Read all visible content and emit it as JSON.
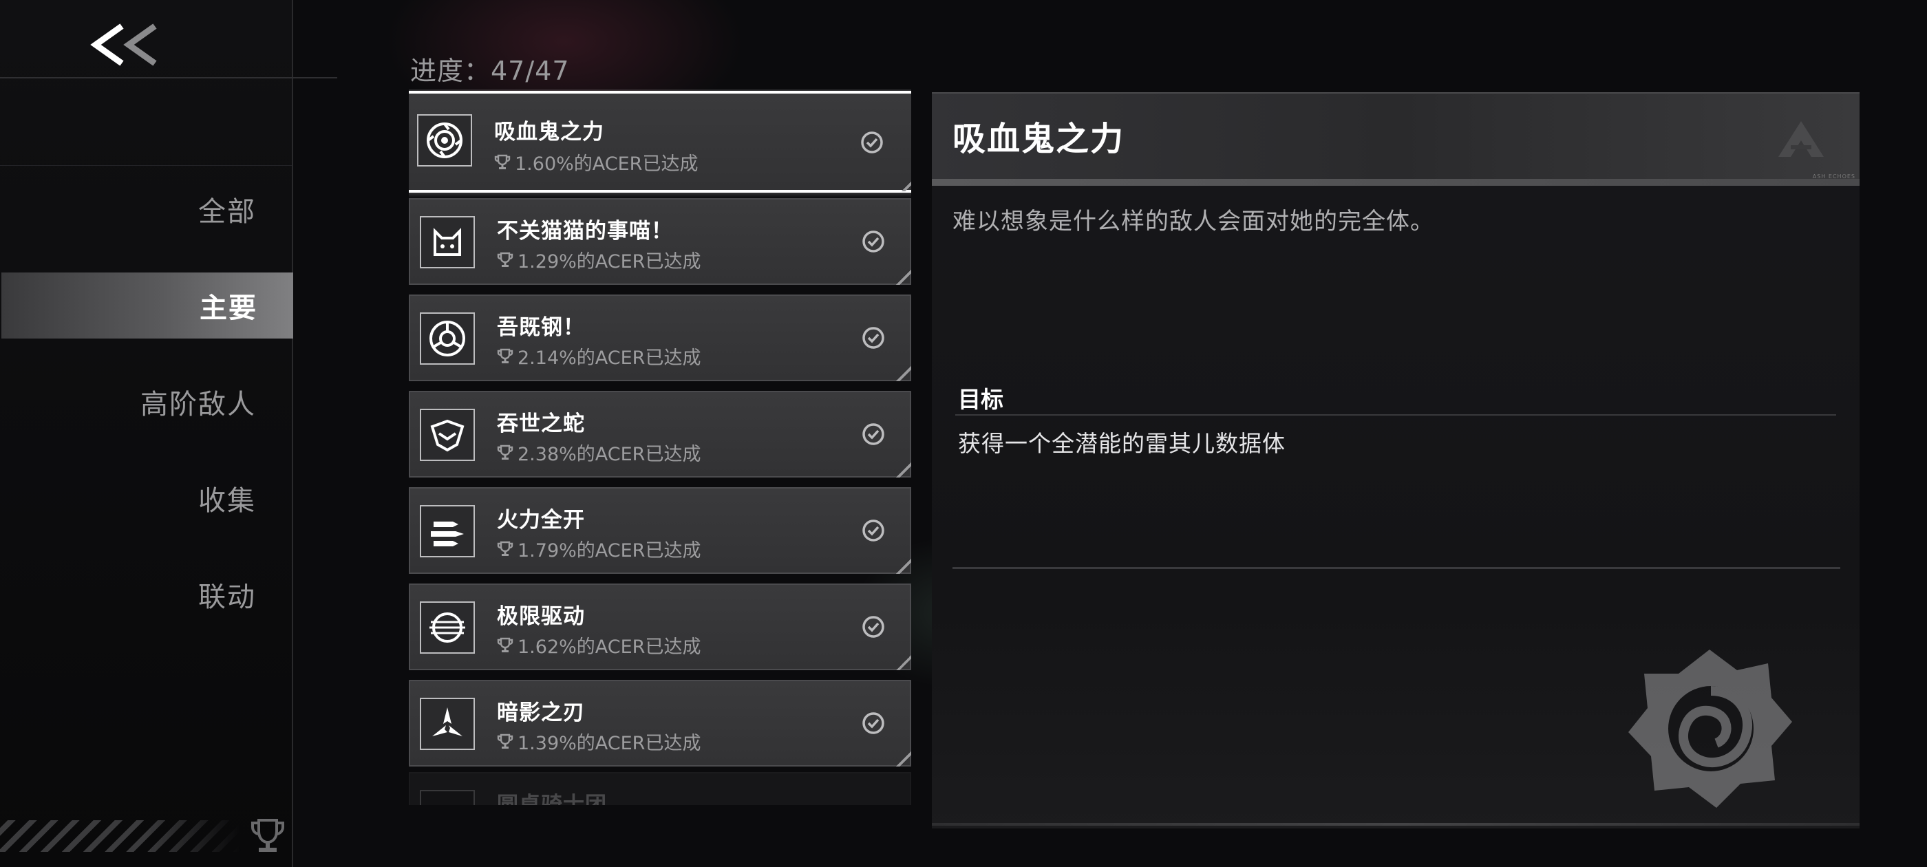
{
  "back_button": {
    "icon": "double-chevron-left-icon"
  },
  "sidebar": {
    "items": [
      {
        "label": "全部",
        "active": false
      },
      {
        "label": "主要",
        "active": true
      },
      {
        "label": "高阶敌人",
        "active": false
      },
      {
        "label": "收集",
        "active": false
      },
      {
        "label": "联动",
        "active": false
      }
    ],
    "footer_icon": "trophy-icon"
  },
  "progress": {
    "text": "进度：47/47"
  },
  "achievements": [
    {
      "title": "吸血鬼之力",
      "rate": "1.60%的ACER已达成",
      "icon": "rose-icon",
      "completed": true,
      "selected": true
    },
    {
      "title": "不关猫猫的事喵！",
      "rate": "1.29%的ACER已达成",
      "icon": "cat-icon",
      "completed": true
    },
    {
      "title": "吾既钢！",
      "rate": "2.14%的ACER已达成",
      "icon": "steel-emblem-icon",
      "completed": true
    },
    {
      "title": "吞世之蛇",
      "rate": "2.38%的ACER已达成",
      "icon": "serpent-icon",
      "completed": true
    },
    {
      "title": "火力全开",
      "rate": "1.79%的ACER已达成",
      "icon": "missiles-icon",
      "completed": true
    },
    {
      "title": "极限驱动",
      "rate": "1.62%的ACER已达成",
      "icon": "speed-drive-icon",
      "completed": true
    },
    {
      "title": "暗影之刃",
      "rate": "1.39%的ACER已达成",
      "icon": "blades-icon",
      "completed": true
    },
    {
      "title": "圆桌骑士团",
      "rate": "",
      "icon": "knight-icon",
      "completed": true,
      "faded": true
    }
  ],
  "detail": {
    "title": "吸血鬼之力",
    "description": "难以想象是什么样的敌人会面对她的完全体。",
    "goal_label": "目标",
    "goal_text": "获得一个全潜能的雷其儿数据体",
    "header_logo_text": "ASH ECHOES",
    "emblem": "rose-icon"
  },
  "colors": {
    "accent": "#ffffff",
    "card_bg": "#3a3a3c",
    "sidebar_active": "#808082",
    "background": "#0b0b0d"
  }
}
